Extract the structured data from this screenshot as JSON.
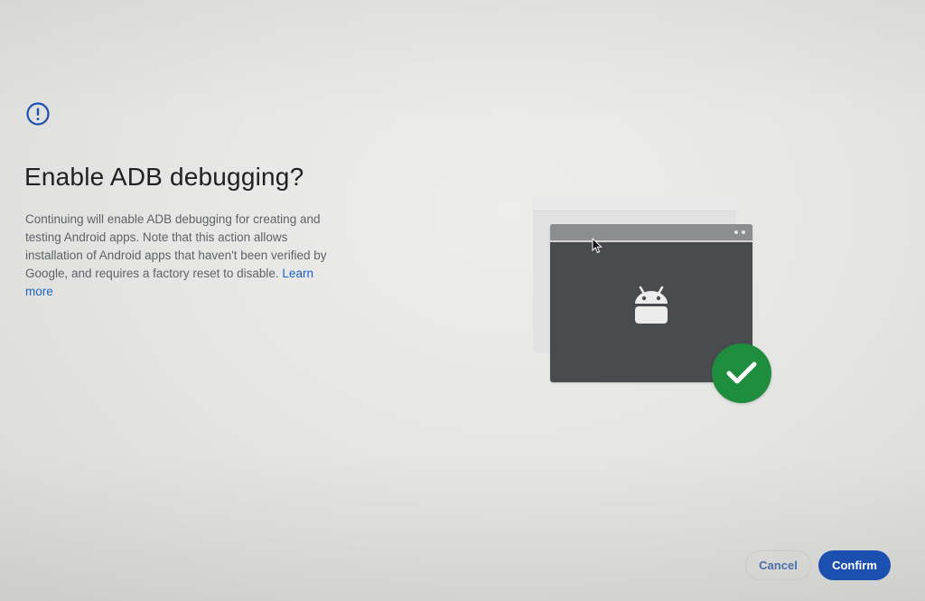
{
  "dialog": {
    "title": "Enable ADB debugging?",
    "description": "Continuing will enable ADB debugging for creating and testing Android apps. Note that this action allows installation of Android apps that haven't been verified by Google, and requires a factory reset to disable. ",
    "learn_more_label": "Learn more"
  },
  "icons": {
    "alert": "alert-circle-icon",
    "android": "android-icon",
    "check": "check-circle-icon",
    "cursor": "mouse-pointer-icon"
  },
  "buttons": {
    "cancel_label": "Cancel",
    "confirm_label": "Confirm"
  },
  "colors": {
    "accent": "#1b4fb0",
    "link": "#1a62c9",
    "success": "#1e8e3e",
    "title_text": "#202124",
    "body_text": "#5f6368"
  }
}
